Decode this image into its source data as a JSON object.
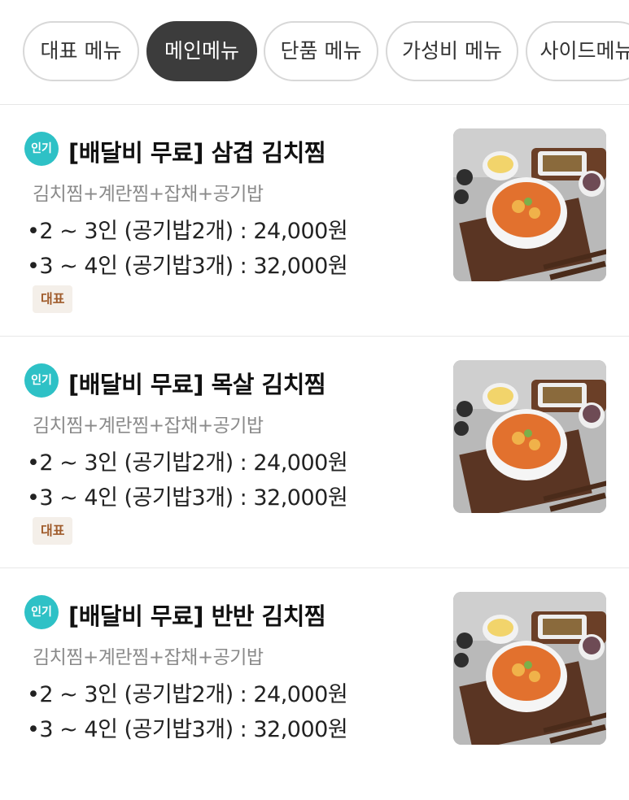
{
  "tabs": [
    {
      "label": "대표 메뉴",
      "active": false
    },
    {
      "label": "메인메뉴",
      "active": true
    },
    {
      "label": "단품 메뉴",
      "active": false
    },
    {
      "label": "가성비 메뉴",
      "active": false
    },
    {
      "label": "사이드메뉴",
      "active": false
    }
  ],
  "menu": [
    {
      "badge": "인기",
      "title": "[배달비 무료] 삼겹 김치찜",
      "description": "김치찜+계란찜+잡채+공기밥",
      "prices": [
        "•2 ~ 3인 (공기밥2개) : 24,000원",
        "•3 ~ 4인 (공기밥3개) : 32,000원"
      ],
      "tag": "대표",
      "image_icon": "food-photo"
    },
    {
      "badge": "인기",
      "title": "[배달비 무료] 목살 김치찜",
      "description": "김치찜+계란찜+잡채+공기밥",
      "prices": [
        "•2 ~ 3인 (공기밥2개) : 24,000원",
        "•3 ~ 4인 (공기밥3개) : 32,000원"
      ],
      "tag": "대표",
      "image_icon": "food-photo"
    },
    {
      "badge": "인기",
      "title": "[배달비 무료] 반반 김치찜",
      "description": "김치찜+계란찜+잡채+공기밥",
      "prices": [
        "•2 ~ 3인 (공기밥2개) : 24,000원",
        "•3 ~ 4인 (공기밥3개) : 32,000원"
      ],
      "tag": "",
      "image_icon": "food-photo"
    }
  ],
  "colors": {
    "accent_badge": "#2ec1c6",
    "active_tab": "#3c3c3c",
    "tag_bg": "#f4efe9",
    "tag_text": "#a05c2c"
  }
}
